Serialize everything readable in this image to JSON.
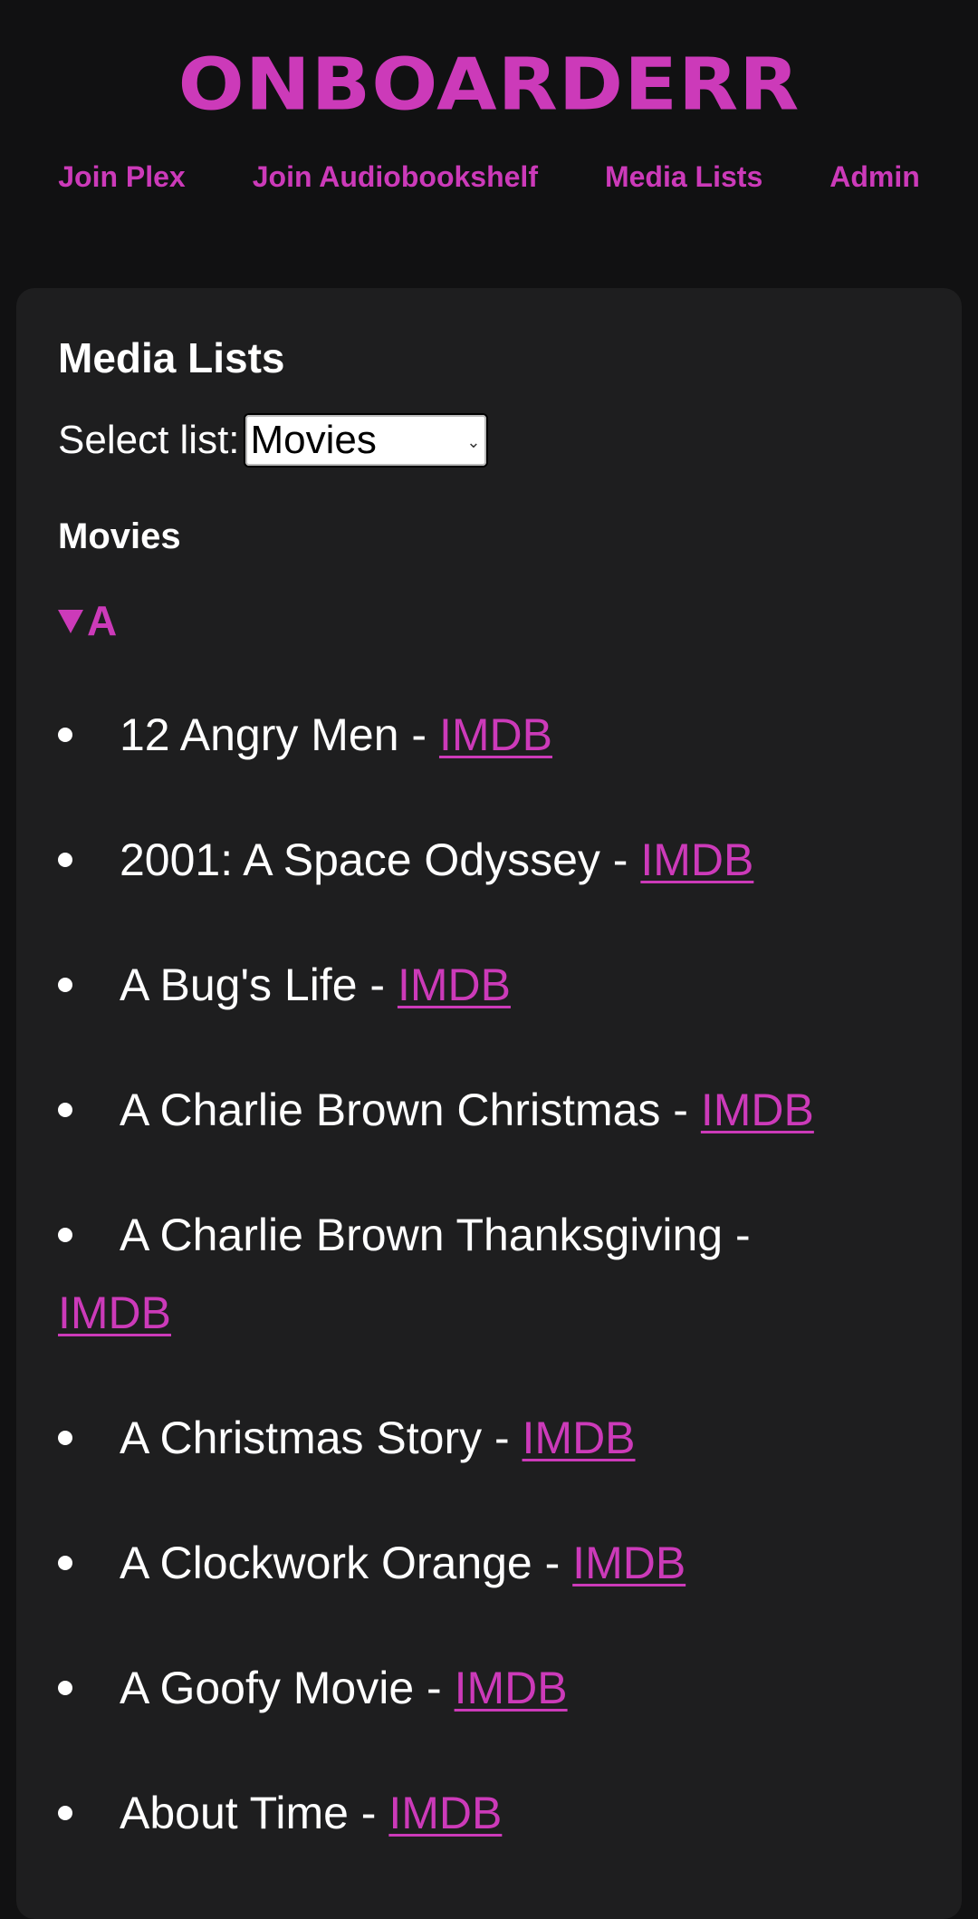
{
  "header": {
    "logo_text": "ONBOARDERR"
  },
  "nav": {
    "items": [
      {
        "label": "Join Plex"
      },
      {
        "label": "Join Audiobookshelf"
      },
      {
        "label": "Media Lists"
      },
      {
        "label": "Admin"
      }
    ]
  },
  "card": {
    "title": "Media Lists",
    "select_label": "Select list:",
    "select_value": "Movies",
    "list_title": "Movies",
    "group_letter": "A",
    "items": [
      {
        "title": "12 Angry Men -",
        "link": "IMDB"
      },
      {
        "title": "2001: A Space Odyssey -",
        "link": "IMDB"
      },
      {
        "title": "A Bug's Life -",
        "link": "IMDB"
      },
      {
        "title": "A Charlie Brown Christmas -",
        "link": "IMDB"
      },
      {
        "title": "A Charlie Brown Thanksgiving -",
        "link": "IMDB"
      },
      {
        "title": "A Christmas Story -",
        "link": "IMDB"
      },
      {
        "title": "A Clockwork Orange -",
        "link": "IMDB"
      },
      {
        "title": "A Goofy Movie -",
        "link": "IMDB"
      },
      {
        "title": "About Time -",
        "link": "IMDB"
      }
    ]
  },
  "colors": {
    "background": "#111112",
    "card": "#1e1e1f",
    "accent": "#cc3ab9",
    "text": "#ffffff"
  }
}
